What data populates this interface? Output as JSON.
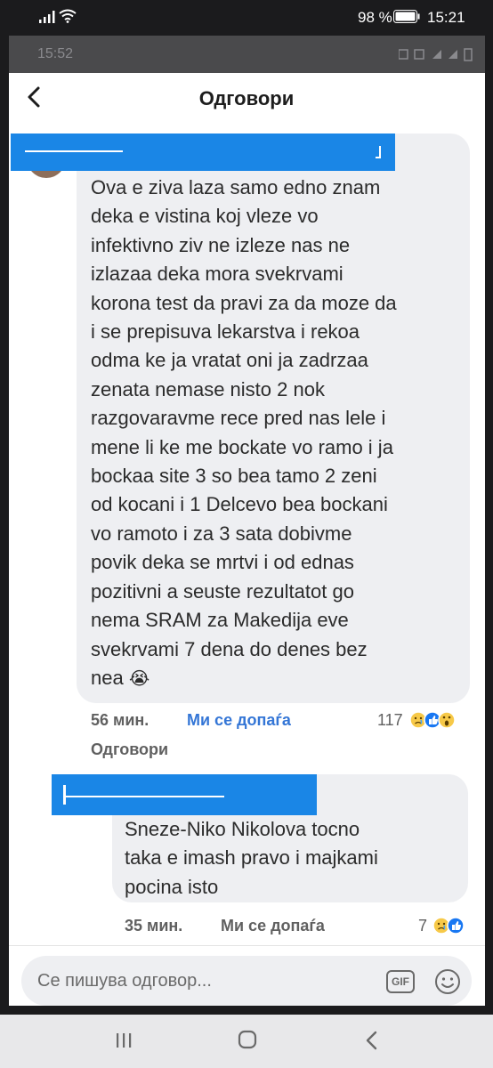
{
  "status_bar": {
    "battery_percent": "98 %",
    "clock": "15:21"
  },
  "inner_status": {
    "clock": "15:52"
  },
  "header": {
    "title": "Одговори"
  },
  "comments": [
    {
      "text": "Ova e ziva laza samo edno znam\ndeka e vistina koj vleze vo\ninfektivno ziv ne izleze nas ne\nizlazaa deka mora svekrvami\nkorona test da pravi za da moze da\ni se prepisuva lekarstva i rekoa\nodma ke ja vratat oni ja zadrzaa\nzenata nemase nisto 2 nok\nrazgovaravme rece pred nas lele i\nmene li ke me bockate vo ramo i ja\nbockaa site 3 so bea tamo 2 zeni\nod kocani i 1 Delcevo bea bockani\nvo ramoto i za 3 sata dobivme\npovik deka se mrtvi i od ednas\npozitivni a seuste rezultatot go\nnema SRAM za Makedija eve\nsvekrvami 7 dena do denes bez\nnea",
      "trailing_emoji": "😭",
      "time": "56 мин.",
      "like_label": "Ми се допаѓа",
      "reaction_count": "117",
      "reply_label": "Одговори"
    },
    {
      "text": "Sneze-Niko Nikolova tocno\ntaka e imash pravo i majkami\npocina isto",
      "time": "35 мин.",
      "like_label": "Ми се допаѓа",
      "reaction_count": "7"
    }
  ],
  "reply_box": {
    "placeholder": "Се пишува одговор...",
    "gif_label": "GIF"
  },
  "colors": {
    "accent": "#3476d6",
    "redaction": "#1a86e6",
    "bubble": "#eeeff2"
  },
  "icons": [
    "signal-icon",
    "wifi-icon",
    "battery-icon",
    "back-arrow-icon",
    "sad-reaction-icon",
    "like-reaction-icon",
    "wow-reaction-icon",
    "gif-icon",
    "emoji-icon",
    "recents-icon",
    "home-icon",
    "nav-back-icon"
  ]
}
